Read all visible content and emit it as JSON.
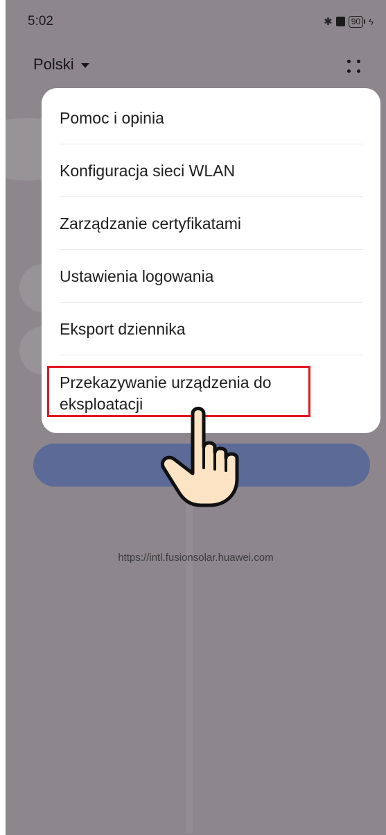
{
  "status_bar": {
    "time": "5:02",
    "battery": "90"
  },
  "header": {
    "language": "Polski"
  },
  "menu": {
    "items": [
      {
        "label": "Pomoc i opinia"
      },
      {
        "label": "Konfiguracja sieci WLAN"
      },
      {
        "label": "Zarządzanie certyfikatami"
      },
      {
        "label": "Ustawienia logowania"
      },
      {
        "label": "Eksport dziennika"
      },
      {
        "label": "Przekazywanie urządzenia do eksploatacji"
      }
    ],
    "highlighted_index": 5
  },
  "footer": {
    "url": "https://intl.fusionsolar.huawei.com"
  },
  "colors": {
    "overlay": "#8d878d",
    "highlight": "#e3151f",
    "button": "#5b6a96"
  }
}
